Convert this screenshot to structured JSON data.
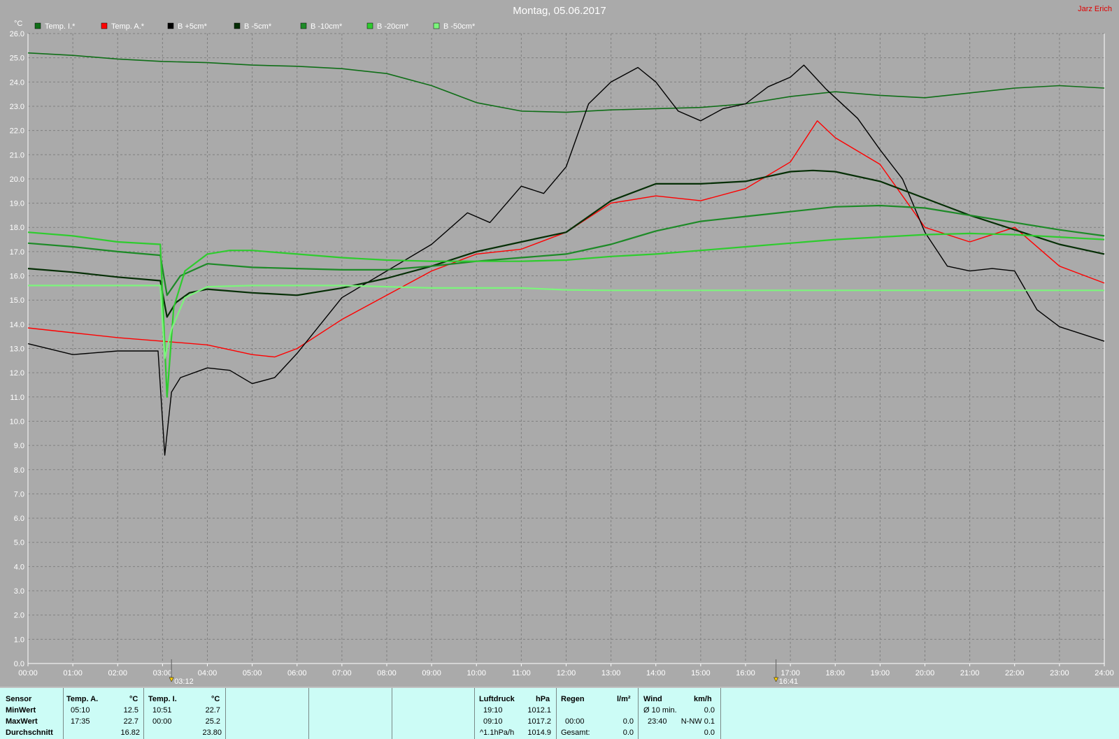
{
  "title": "Montag, 05.06.2017",
  "author": "Jarz Erich",
  "colors": {
    "background": "#aaaaaa",
    "grid": "#808080",
    "stats_bg": "#ccfcf6"
  },
  "chart_data": {
    "type": "line",
    "ylabel": "°C",
    "ylim": [
      0,
      26
    ],
    "xlim": [
      0,
      24
    ],
    "y_ticks": [
      "0.0",
      "1.0",
      "2.0",
      "3.0",
      "4.0",
      "5.0",
      "6.0",
      "7.0",
      "8.0",
      "9.0",
      "10.0",
      "11.0",
      "12.0",
      "13.0",
      "14.0",
      "15.0",
      "16.0",
      "17.0",
      "18.0",
      "19.0",
      "20.0",
      "21.0",
      "22.0",
      "23.0",
      "24.0",
      "25.0",
      "26.0"
    ],
    "x_ticks": [
      "00:00",
      "01:00",
      "02:00",
      "03:00",
      "04:00",
      "05:00",
      "06:00",
      "07:00",
      "08:00",
      "09:00",
      "10:00",
      "11:00",
      "12:00",
      "13:00",
      "14:00",
      "15:00",
      "16:00",
      "17:00",
      "18:00",
      "19:00",
      "20:00",
      "21:00",
      "22:00",
      "23:00",
      "24:00"
    ],
    "grid": true,
    "legend_position": "top-left",
    "markers": [
      {
        "x": 3.2,
        "label": "03:12"
      },
      {
        "x": 16.68,
        "label": "16:41"
      }
    ],
    "series": [
      {
        "name": "Temp. I.*",
        "color": "#0f6e17",
        "width": 1.6,
        "points": [
          [
            0,
            25.2
          ],
          [
            1,
            25.1
          ],
          [
            2,
            24.95
          ],
          [
            3,
            24.85
          ],
          [
            4,
            24.8
          ],
          [
            5,
            24.7
          ],
          [
            6,
            24.65
          ],
          [
            7,
            24.55
          ],
          [
            8,
            24.35
          ],
          [
            9,
            23.85
          ],
          [
            10,
            23.15
          ],
          [
            11,
            22.8
          ],
          [
            12,
            22.75
          ],
          [
            13,
            22.85
          ],
          [
            14,
            22.9
          ],
          [
            15,
            22.95
          ],
          [
            16,
            23.1
          ],
          [
            17,
            23.4
          ],
          [
            18,
            23.6
          ],
          [
            19,
            23.45
          ],
          [
            20,
            23.35
          ],
          [
            21,
            23.55
          ],
          [
            22,
            23.75
          ],
          [
            23,
            23.85
          ],
          [
            24,
            23.75
          ]
        ]
      },
      {
        "name": "Temp. A.*",
        "color": "#ff0000",
        "width": 1.4,
        "points": [
          [
            0,
            13.85
          ],
          [
            1,
            13.65
          ],
          [
            2,
            13.45
          ],
          [
            3,
            13.3
          ],
          [
            4,
            13.15
          ],
          [
            5,
            12.75
          ],
          [
            5.5,
            12.65
          ],
          [
            6,
            13.0
          ],
          [
            7,
            14.2
          ],
          [
            8,
            15.2
          ],
          [
            9,
            16.2
          ],
          [
            10,
            16.9
          ],
          [
            11,
            17.1
          ],
          [
            12,
            17.8
          ],
          [
            13,
            19.0
          ],
          [
            14,
            19.3
          ],
          [
            15,
            19.1
          ],
          [
            16,
            19.6
          ],
          [
            17,
            20.7
          ],
          [
            17.6,
            22.4
          ],
          [
            18,
            21.7
          ],
          [
            19,
            20.6
          ],
          [
            20,
            18.0
          ],
          [
            21,
            17.4
          ],
          [
            22,
            18.0
          ],
          [
            23,
            16.4
          ],
          [
            24,
            15.7
          ]
        ]
      },
      {
        "name": "B +5cm*",
        "color": "#000000",
        "width": 1.4,
        "points": [
          [
            0,
            13.2
          ],
          [
            1,
            12.75
          ],
          [
            2,
            12.9
          ],
          [
            2.9,
            12.9
          ],
          [
            3.05,
            8.6
          ],
          [
            3.2,
            11.2
          ],
          [
            3.4,
            11.8
          ],
          [
            4,
            12.2
          ],
          [
            4.5,
            12.1
          ],
          [
            5,
            11.55
          ],
          [
            5.5,
            11.8
          ],
          [
            6,
            12.8
          ],
          [
            7,
            15.1
          ],
          [
            8,
            16.2
          ],
          [
            9,
            17.3
          ],
          [
            9.8,
            18.6
          ],
          [
            10.3,
            18.2
          ],
          [
            11,
            19.7
          ],
          [
            11.5,
            19.4
          ],
          [
            12,
            20.5
          ],
          [
            12.5,
            23.1
          ],
          [
            13,
            24.0
          ],
          [
            13.6,
            24.6
          ],
          [
            14,
            24.0
          ],
          [
            14.5,
            22.8
          ],
          [
            15,
            22.4
          ],
          [
            15.5,
            22.9
          ],
          [
            16,
            23.1
          ],
          [
            16.5,
            23.8
          ],
          [
            17,
            24.2
          ],
          [
            17.3,
            24.7
          ],
          [
            17.8,
            23.7
          ],
          [
            18.5,
            22.5
          ],
          [
            19,
            21.2
          ],
          [
            19.5,
            20.0
          ],
          [
            20,
            17.8
          ],
          [
            20.5,
            16.4
          ],
          [
            21,
            16.2
          ],
          [
            21.5,
            16.3
          ],
          [
            22,
            16.2
          ],
          [
            22.5,
            14.6
          ],
          [
            23,
            13.9
          ],
          [
            24,
            13.3
          ]
        ]
      },
      {
        "name": "B -5cm*",
        "color": "#052e05",
        "width": 2.2,
        "points": [
          [
            0,
            16.3
          ],
          [
            1,
            16.15
          ],
          [
            2,
            15.95
          ],
          [
            2.95,
            15.8
          ],
          [
            3.1,
            14.3
          ],
          [
            3.3,
            14.9
          ],
          [
            3.6,
            15.3
          ],
          [
            4,
            15.45
          ],
          [
            5,
            15.3
          ],
          [
            6,
            15.2
          ],
          [
            7,
            15.5
          ],
          [
            8,
            15.9
          ],
          [
            9,
            16.4
          ],
          [
            10,
            17.0
          ],
          [
            11,
            17.4
          ],
          [
            12,
            17.8
          ],
          [
            13,
            19.1
          ],
          [
            14,
            19.8
          ],
          [
            15,
            19.8
          ],
          [
            16,
            19.9
          ],
          [
            17,
            20.3
          ],
          [
            17.5,
            20.35
          ],
          [
            18,
            20.3
          ],
          [
            19,
            19.9
          ],
          [
            20,
            19.2
          ],
          [
            21,
            18.5
          ],
          [
            22,
            17.9
          ],
          [
            23,
            17.3
          ],
          [
            24,
            16.9
          ]
        ]
      },
      {
        "name": "B -10cm*",
        "color": "#1d8a27",
        "width": 2.2,
        "points": [
          [
            0,
            17.35
          ],
          [
            1,
            17.2
          ],
          [
            2,
            17.0
          ],
          [
            2.95,
            16.85
          ],
          [
            3.1,
            15.2
          ],
          [
            3.4,
            16.0
          ],
          [
            4,
            16.5
          ],
          [
            5,
            16.35
          ],
          [
            6,
            16.3
          ],
          [
            7,
            16.25
          ],
          [
            8,
            16.25
          ],
          [
            9,
            16.4
          ],
          [
            10,
            16.6
          ],
          [
            11,
            16.75
          ],
          [
            12,
            16.9
          ],
          [
            13,
            17.3
          ],
          [
            14,
            17.85
          ],
          [
            15,
            18.25
          ],
          [
            16,
            18.45
          ],
          [
            17,
            18.65
          ],
          [
            18,
            18.85
          ],
          [
            19,
            18.9
          ],
          [
            20,
            18.8
          ],
          [
            21,
            18.5
          ],
          [
            22,
            18.2
          ],
          [
            23,
            17.9
          ],
          [
            24,
            17.65
          ]
        ]
      },
      {
        "name": "B -20cm*",
        "color": "#2ecc2e",
        "width": 2.2,
        "points": [
          [
            0,
            17.8
          ],
          [
            1,
            17.65
          ],
          [
            2,
            17.4
          ],
          [
            2.95,
            17.3
          ],
          [
            3.1,
            11.0
          ],
          [
            3.25,
            14.7
          ],
          [
            3.5,
            16.2
          ],
          [
            4,
            16.9
          ],
          [
            4.5,
            17.05
          ],
          [
            5,
            17.05
          ],
          [
            6,
            16.9
          ],
          [
            7,
            16.75
          ],
          [
            8,
            16.65
          ],
          [
            9,
            16.6
          ],
          [
            10,
            16.6
          ],
          [
            11,
            16.6
          ],
          [
            12,
            16.65
          ],
          [
            13,
            16.8
          ],
          [
            14,
            16.9
          ],
          [
            15,
            17.05
          ],
          [
            16,
            17.2
          ],
          [
            17,
            17.35
          ],
          [
            18,
            17.5
          ],
          [
            19,
            17.6
          ],
          [
            20,
            17.7
          ],
          [
            21,
            17.75
          ],
          [
            22,
            17.7
          ],
          [
            23,
            17.6
          ],
          [
            24,
            17.5
          ]
        ]
      },
      {
        "name": "B -50cm*",
        "color": "#7cf57c",
        "width": 2.2,
        "points": [
          [
            0,
            15.6
          ],
          [
            1,
            15.6
          ],
          [
            2,
            15.6
          ],
          [
            2.95,
            15.6
          ],
          [
            3.05,
            12.6
          ],
          [
            3.2,
            13.8
          ],
          [
            3.5,
            15.1
          ],
          [
            4,
            15.55
          ],
          [
            5,
            15.6
          ],
          [
            6,
            15.6
          ],
          [
            7,
            15.6
          ],
          [
            8,
            15.55
          ],
          [
            9,
            15.5
          ],
          [
            10,
            15.5
          ],
          [
            11,
            15.5
          ],
          [
            12,
            15.42
          ],
          [
            13,
            15.4
          ],
          [
            14,
            15.4
          ],
          [
            15,
            15.4
          ],
          [
            16,
            15.4
          ],
          [
            17,
            15.4
          ],
          [
            18,
            15.4
          ],
          [
            19,
            15.4
          ],
          [
            20,
            15.4
          ],
          [
            21,
            15.4
          ],
          [
            22,
            15.4
          ],
          [
            23,
            15.4
          ],
          [
            24,
            15.4
          ]
        ]
      }
    ]
  },
  "stats": {
    "row_labels": {
      "sensor": "Sensor",
      "min": "MinWert",
      "max": "MaxWert",
      "avg": "Durchschnitt"
    },
    "temp_a": {
      "header": "Temp. A.",
      "unit": "°C",
      "min_time": "05:10",
      "min_val": "12.5",
      "max_time": "17:35",
      "max_val": "22.7",
      "avg": "16.82"
    },
    "temp_i": {
      "header": "Temp. I.",
      "unit": "°C",
      "min_time": "10:51",
      "min_val": "22.7",
      "max_time": "00:00",
      "max_val": "25.2",
      "avg": "23.80"
    },
    "pressure": {
      "header": "Luftdruck",
      "unit": "hPa",
      "min_time": "19:10",
      "min_val": "1012.1",
      "max_time": "09:10",
      "max_val": "1017.2",
      "trend": "^1.1hPa/h",
      "trend_val": "1014.9"
    },
    "rain": {
      "header": "Regen",
      "unit": "l/m²",
      "time": "00:00",
      "val": "0.0",
      "total_label": "Gesamt:",
      "total": "0.0"
    },
    "wind": {
      "header": "Wind",
      "unit": "km/h",
      "avg_label": "Ø 10 min.",
      "avg_val": "0.0",
      "max_time": "23:40",
      "max_val": "N-NW 0.1",
      "extra": "0.0"
    }
  }
}
